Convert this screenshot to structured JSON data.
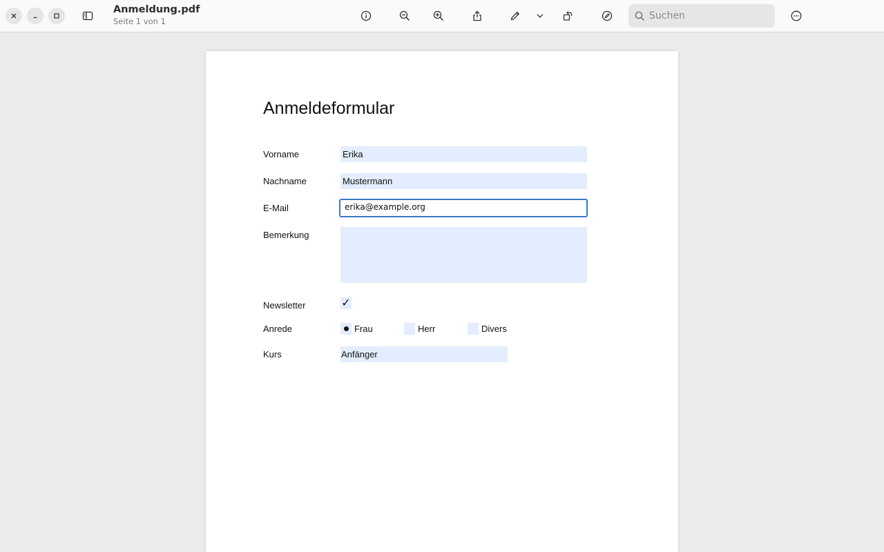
{
  "window": {
    "file_name": "Anmeldung.pdf",
    "page_info": "Seite 1 von 1"
  },
  "toolbar": {
    "icons": [
      "sidebar-toggle-icon",
      "info-icon",
      "zoom-out-icon",
      "zoom-in-icon",
      "share-icon",
      "pencil-icon",
      "chevron-down-icon",
      "rotate-icon",
      "markup-icon",
      "more-icon"
    ],
    "search_placeholder": "Suchen"
  },
  "form": {
    "title": "Anmeldeformular",
    "vorname_label": "Vorname",
    "vorname_value": "Erika",
    "nachname_label": "Nachname",
    "nachname_value": "Mustermann",
    "email_label": "E-Mail",
    "email_value": "erika@example.org",
    "bemerkung_label": "Bemerkung",
    "bemerkung_value": "",
    "newsletter_label": "Newsletter",
    "newsletter_checked": true,
    "newsletter_mark": "✓",
    "anrede_label": "Anrede",
    "anrede_options": [
      "Frau",
      "Herr",
      "Divers"
    ],
    "anrede_selected": "Frau",
    "kurs_label": "Kurs",
    "kurs_value": "Anfänger"
  },
  "colors": {
    "field_background": "#e3edfd",
    "focus_border": "#3a78c7"
  }
}
